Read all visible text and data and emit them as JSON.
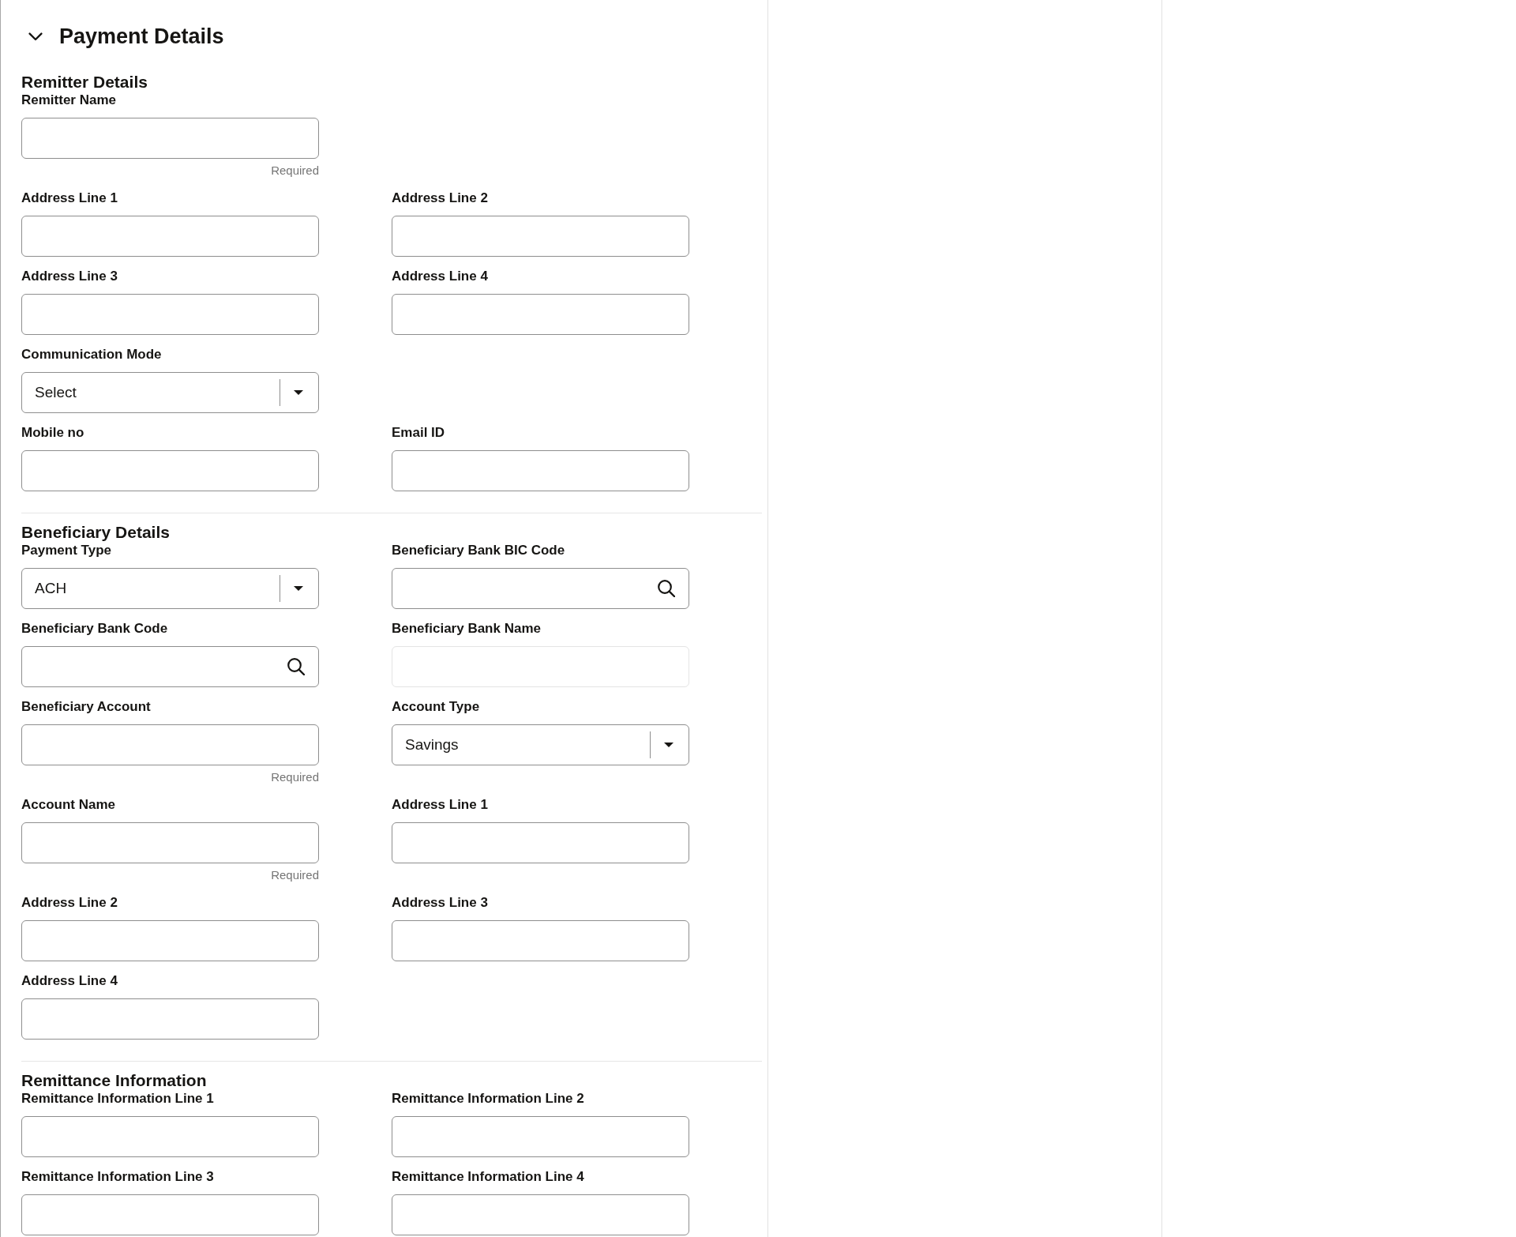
{
  "panel": {
    "title": "Payment Details",
    "expanded": true
  },
  "sections": [
    {
      "heading": "Remitter Details",
      "rows": [
        [
          {
            "label": "Remitter Name",
            "kind": "text",
            "disabled": false,
            "helper": "Required"
          }
        ],
        [
          {
            "label": "Address Line 1",
            "kind": "text",
            "disabled": false
          },
          {
            "label": "Address Line 2",
            "kind": "text",
            "disabled": false
          }
        ],
        [
          {
            "label": "Address Line 3",
            "kind": "text",
            "disabled": false
          },
          {
            "label": "Address Line 4",
            "kind": "text",
            "disabled": false
          }
        ],
        [
          {
            "label": "Communication Mode",
            "kind": "select",
            "value": "Select",
            "disabled": false
          }
        ],
        [
          {
            "label": "Mobile no",
            "kind": "text",
            "disabled": false
          },
          {
            "label": "Email ID",
            "kind": "text",
            "disabled": false
          }
        ]
      ]
    },
    {
      "heading": "Beneficiary Details",
      "rows": [
        [
          {
            "label": "Payment Type",
            "kind": "select",
            "value": "ACH",
            "disabled": false
          },
          {
            "label": "Beneficiary Bank BIC Code",
            "kind": "search",
            "disabled": false
          }
        ],
        [
          {
            "label": "Beneficiary Bank Code",
            "kind": "search",
            "disabled": false
          },
          {
            "label": "Beneficiary Bank Name",
            "kind": "text",
            "disabled": true
          }
        ],
        [
          {
            "label": "Beneficiary Account",
            "kind": "text",
            "disabled": false,
            "helper": "Required"
          },
          {
            "label": "Account Type",
            "kind": "select",
            "value": "Savings",
            "disabled": false
          }
        ],
        [
          {
            "label": "Account Name",
            "kind": "text",
            "disabled": false,
            "helper": "Required"
          },
          {
            "label": "Address Line 1",
            "kind": "text",
            "disabled": false
          }
        ],
        [
          {
            "label": "Address Line 2",
            "kind": "text",
            "disabled": false
          },
          {
            "label": "Address Line 3",
            "kind": "text",
            "disabled": false
          }
        ],
        [
          {
            "label": "Address Line 4",
            "kind": "text",
            "disabled": false
          }
        ]
      ]
    },
    {
      "heading": "Remittance Information",
      "rows": [
        [
          {
            "label": "Remittance Information Line 1",
            "kind": "text",
            "disabled": false
          },
          {
            "label": "Remittance Information Line 2",
            "kind": "text",
            "disabled": false
          }
        ],
        [
          {
            "label": "Remittance Information Line 3",
            "kind": "text",
            "disabled": false
          },
          {
            "label": "Remittance Information Line 4",
            "kind": "text",
            "disabled": false
          }
        ]
      ]
    }
  ]
}
